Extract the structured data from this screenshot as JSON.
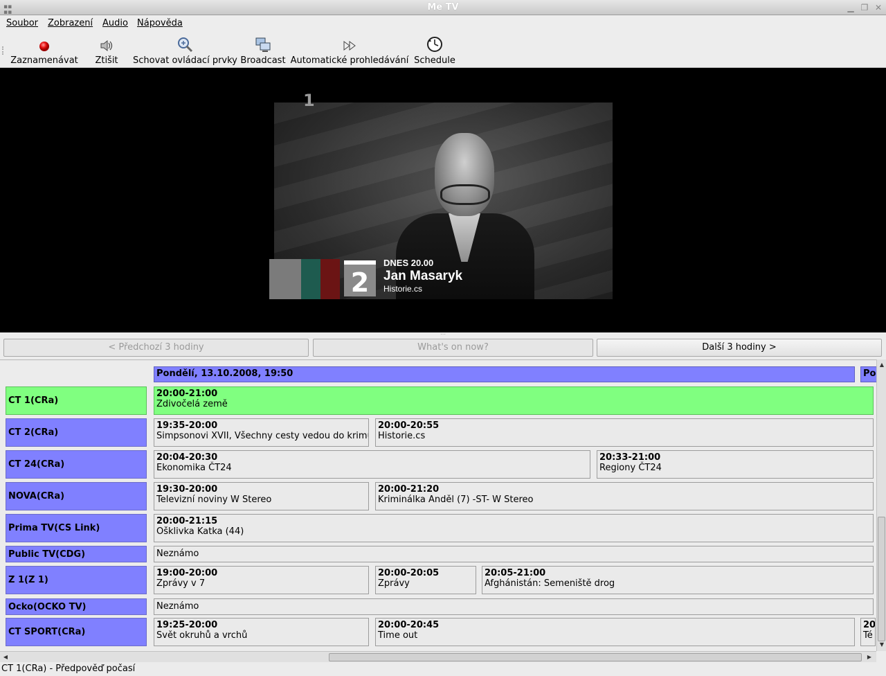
{
  "window": {
    "title": "Me TV"
  },
  "menu": [
    {
      "label": "Soubor",
      "name": "menu-soubor"
    },
    {
      "label": "Zobrazení",
      "name": "menu-zobrazeni"
    },
    {
      "label": "Audio",
      "name": "menu-audio"
    },
    {
      "label": "Nápověda",
      "name": "menu-napoveda"
    }
  ],
  "toolbar": {
    "record": "Zaznamenávat",
    "mute": "Ztišit",
    "hide_controls": "Schovat ovládací prvky",
    "broadcast": "Broadcast",
    "autoscan": "Automatické prohledávání",
    "schedule": "Schedule"
  },
  "video": {
    "channel_logo": "1",
    "overlay": {
      "channel_number": "2",
      "line1": "DNES 20.00",
      "line2": "Jan Masaryk",
      "line3": "Historie.cs"
    }
  },
  "nav": {
    "prev": "< Předchozí 3 hodiny",
    "now": "What's on now?",
    "next": "Další 3 hodiny >"
  },
  "epg": {
    "date_header": "Pondělí, 13.10.2008, 19:50",
    "date_header_next": "Pondělí",
    "channels": [
      {
        "name": "CT 1(CRa)",
        "current": true,
        "programs": [
          {
            "time": "20:00-21:00",
            "title": "Zdivočelá země"
          }
        ]
      },
      {
        "name": "CT 2(CRa)",
        "current": false,
        "programs": [
          {
            "time": "19:35-20:00",
            "title": "Simpsonovi XVII, Všechny cesty vedou do krimu"
          },
          {
            "time": "20:00-20:55",
            "title": "Historie.cs"
          }
        ]
      },
      {
        "name": "CT 24(CRa)",
        "current": false,
        "programs": [
          {
            "time": "20:04-20:30",
            "title": "Ekonomika ČT24"
          },
          {
            "time": "20:33-21:00",
            "title": "Regiony ČT24"
          }
        ]
      },
      {
        "name": "NOVA(CRa)",
        "current": false,
        "programs": [
          {
            "time": "19:30-20:00",
            "title": "Televizní noviny W Stereo"
          },
          {
            "time": "20:00-21:20",
            "title": "Kriminálka Anděl (7) -ST- W Stereo"
          }
        ]
      },
      {
        "name": "Prima TV(CS Link)",
        "current": false,
        "programs": [
          {
            "time": "20:00-21:15",
            "title": "Ošklivka Katka (44)"
          }
        ]
      },
      {
        "name": "Public TV(CDG)",
        "current": false,
        "programs": [
          {
            "time": "",
            "title": "Neznámo"
          }
        ]
      },
      {
        "name": "Z 1(Z 1)",
        "current": false,
        "programs": [
          {
            "time": "19:00-20:00",
            "title": "Zprávy v 7"
          },
          {
            "time": "20:00-20:05",
            "title": "Zprávy"
          },
          {
            "time": "20:05-21:00",
            "title": "Afghánistán: Semeniště drog"
          }
        ]
      },
      {
        "name": "Ocko(OCKO TV)",
        "current": false,
        "programs": [
          {
            "time": "",
            "title": "Neznámo"
          }
        ]
      },
      {
        "name": "CT SPORT(CRa)",
        "current": false,
        "programs": [
          {
            "time": "19:25-20:00",
            "title": "Svět okruhů a vrchů"
          },
          {
            "time": "20:00-20:45",
            "title": "Time out"
          },
          {
            "time": "20",
            "title": "Té"
          }
        ]
      }
    ]
  },
  "status": {
    "text": "CT 1(CRa) - Předpověď počasí"
  }
}
